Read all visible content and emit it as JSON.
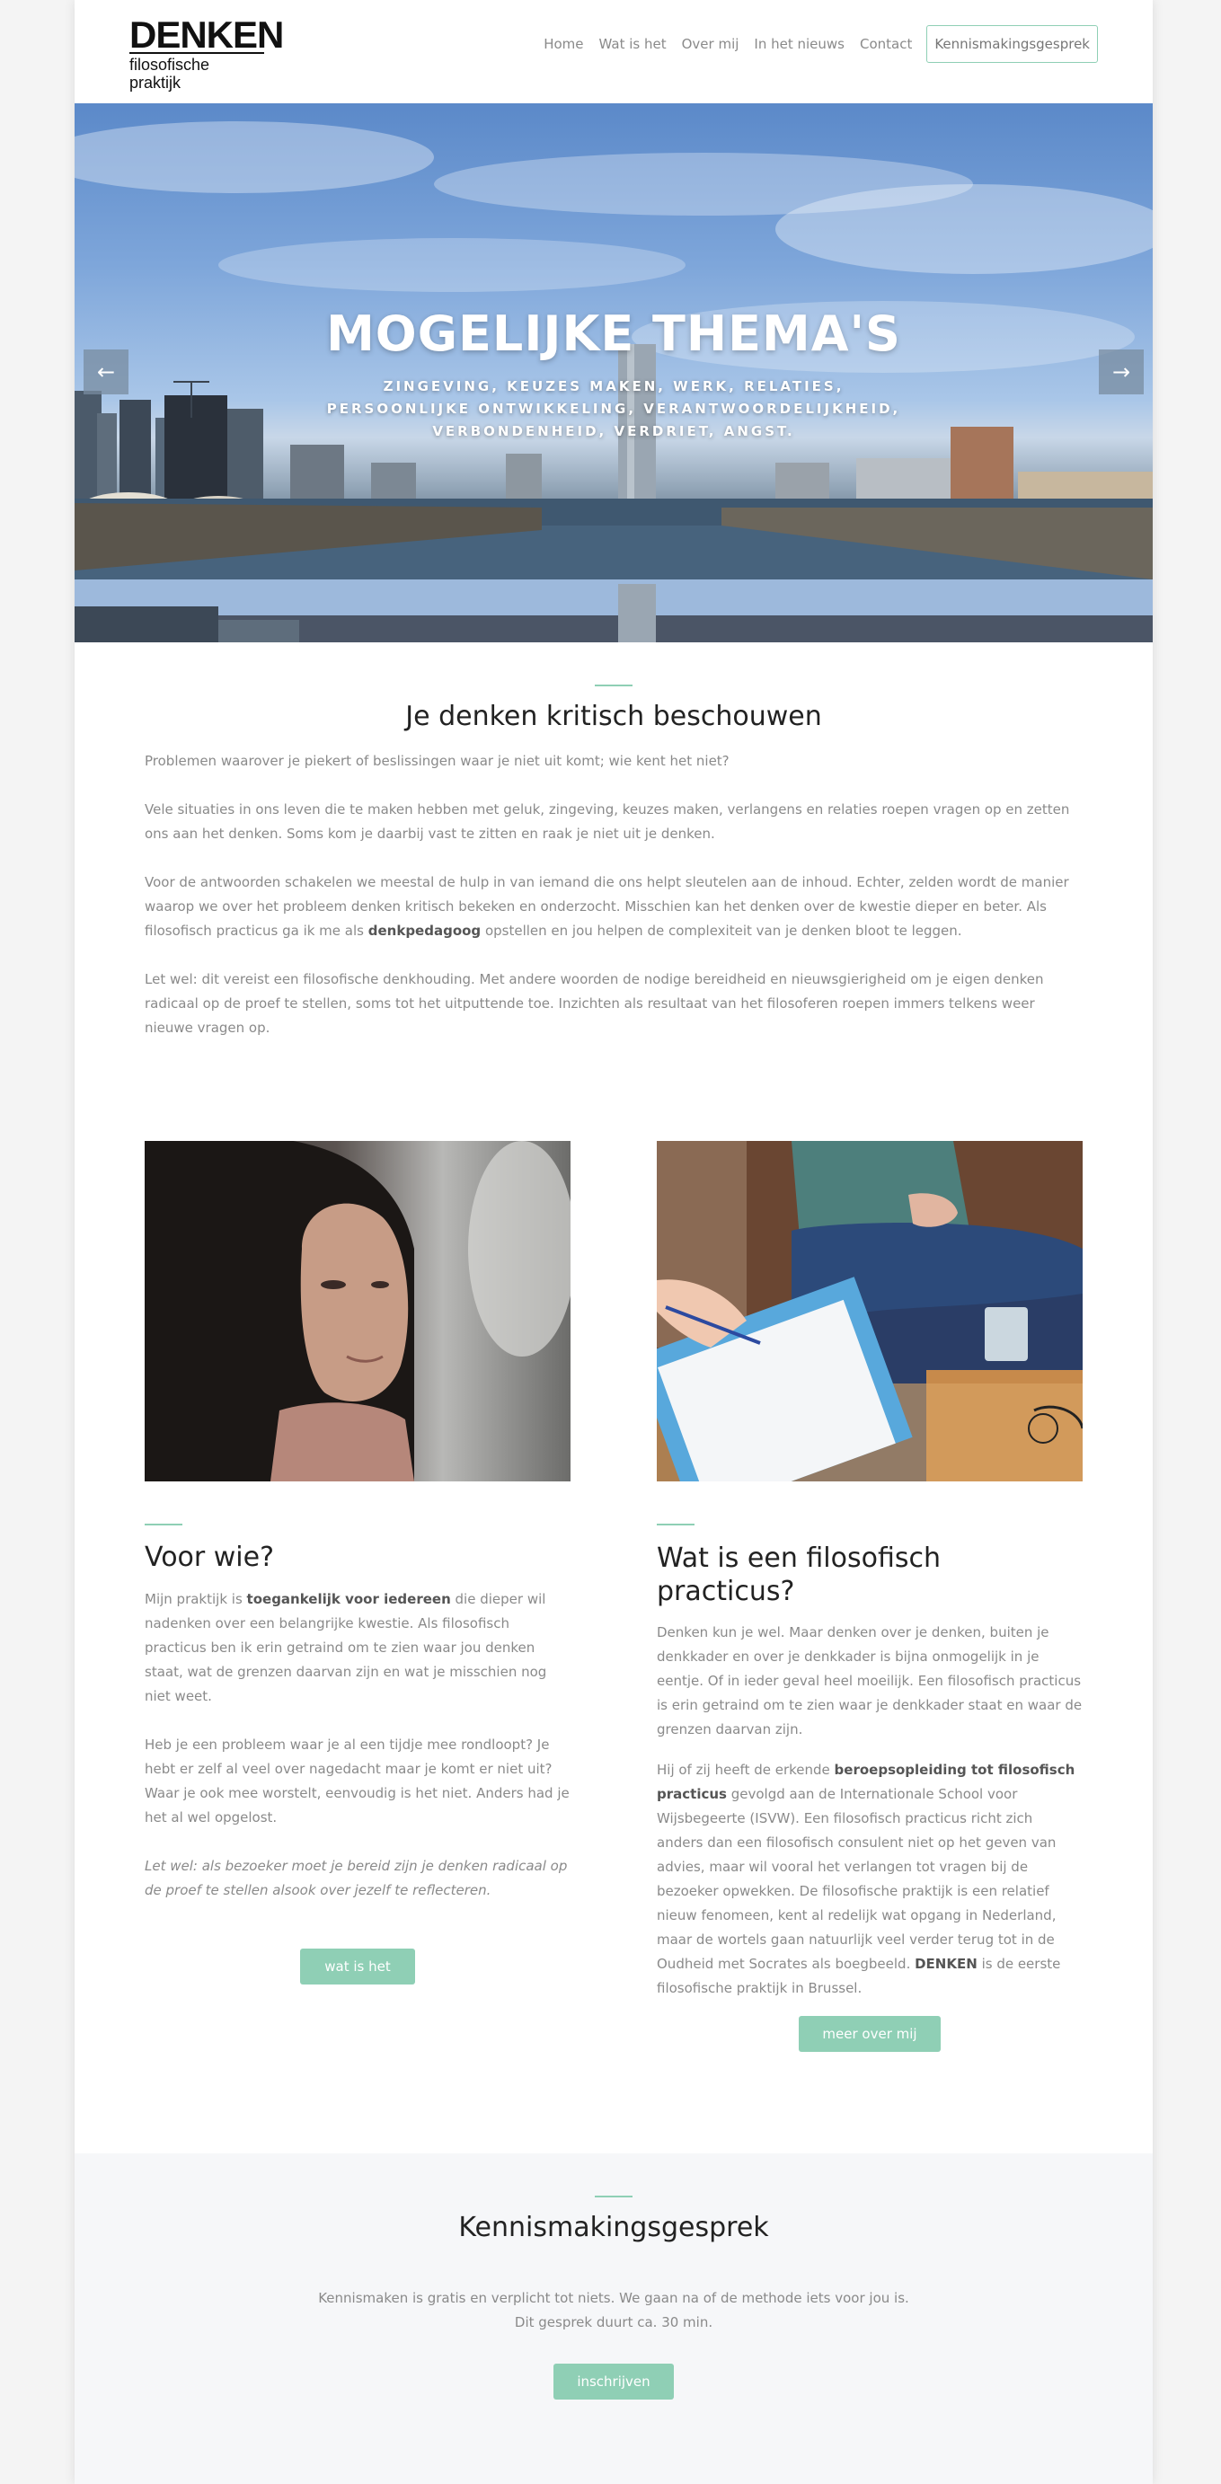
{
  "header": {
    "logo_title": "DENKEN",
    "logo_subtitle": "filosofische praktijk",
    "nav": [
      "Home",
      "Wat is het",
      "Over mij",
      "In het nieuws",
      "Contact"
    ],
    "nav_cta": "Kennismakingsgesprek"
  },
  "hero": {
    "title": "MOGELIJKE THEMA'S",
    "subtitle": "ZINGEVING, KEUZES MAKEN, WERK, RELATIES, PERSOONLIJKE ONTWIKKELING, VERANTWOORDELIJKHEID, VERBONDENHEID, VERDRIET, ANGST.",
    "prev_icon": "arrow-left-icon",
    "next_icon": "arrow-right-icon"
  },
  "intro": {
    "heading": "Je denken kritisch beschouwen",
    "p1": "Problemen waarover je piekert of beslissingen waar je niet uit komt; wie kent het niet?",
    "p2": "Vele situaties in ons leven die te maken hebben met geluk, zingeving, keuzes maken, verlangens en relaties roepen vragen op en zetten ons aan het denken. Soms kom je daarbij vast te zitten en raak je niet uit je denken.",
    "p3_a": "Voor de antwoorden schakelen we meestal de hulp in van iemand die ons helpt sleutelen aan de inhoud. Echter, zelden wordt de manier waarop we over het probleem denken kritisch bekeken en onderzocht. Misschien kan het denken over de kwestie dieper en beter. Als filosofisch practicus ga ik me als ",
    "p3_bold": "denkpedagoog",
    "p3_b": " opstellen en jou helpen de complexiteit van je denken bloot te leggen.",
    "p4": "Let wel: dit vereist een filosofische denkhouding. Met andere woorden de nodige bereidheid en nieuwsgierigheid om je eigen denken radicaal op de proef te stellen, soms tot het uitputtende toe. Inzichten als resultaat van het filosoferen roepen immers telkens weer nieuwe vragen op."
  },
  "col_left": {
    "heading": "Voor wie?",
    "p1_a": "Mijn praktijk is ",
    "p1_bold": "toegankelijk voor iedereen",
    "p1_b": " die dieper wil nadenken over een belangrijke kwestie. Als filosofisch practicus ben ik erin getraind om te zien waar jou denken staat, wat de grenzen daarvan zijn en wat je misschien nog niet weet.",
    "p2": "Heb je een probleem waar je al een tijdje mee rondloopt? Je hebt er zelf al veel over nagedacht maar je komt er niet uit? Waar je ook mee worstelt, eenvoudig is het niet. Anders had je het al wel opgelost.",
    "p3": "Let wel: als bezoeker moet je bereid zijn je denken radicaal op de proef te stellen alsook over jezelf te reflecteren.",
    "button": "wat is het"
  },
  "col_right": {
    "heading": "Wat is een filosofisch practicus?",
    "p1": "Denken kun je wel. Maar denken over je denken, buiten je denkkader en over je denkkader is bijna onmogelijk in je eentje. Of in ieder geval heel moeilijk. Een filosofisch practicus is erin getraind om te zien waar je denkkader staat en waar de grenzen daarvan zijn.",
    "p2_a": "Hij of zij heeft de erkende ",
    "p2_bold": "beroepsopleiding tot filosofisch practicus",
    "p2_b": " gevolgd aan de Internationale School voor Wijsbegeerte (ISVW). Een filosofisch practicus richt zich anders dan een filosofisch consulent niet op het geven van advies, maar wil vooral het verlangen tot vragen bij de bezoeker opwekken. De filosofische praktijk is een relatief nieuw fenomeen, kent al redelijk wat opgang in Nederland, maar de wortels gaan natuurlijk veel verder terug tot in de Oudheid met Socrates als boegbeeld. ",
    "p2_bold2": "DENKEN",
    "p2_c": " is de eerste filosofische praktijk in Brussel.",
    "button": "meer over mij"
  },
  "cta": {
    "heading": "Kennismakingsgesprek",
    "line1": "Kennismaken is gratis en verplicht tot niets. We gaan na of de methode iets voor jou is.",
    "line2": "Dit gesprek duurt ca. 30 min.",
    "button": "inschrijven"
  },
  "colors": {
    "accent": "#8fcfb5",
    "text": "#8a8a8a",
    "heading": "#222222",
    "band": "#f6f7f9"
  }
}
